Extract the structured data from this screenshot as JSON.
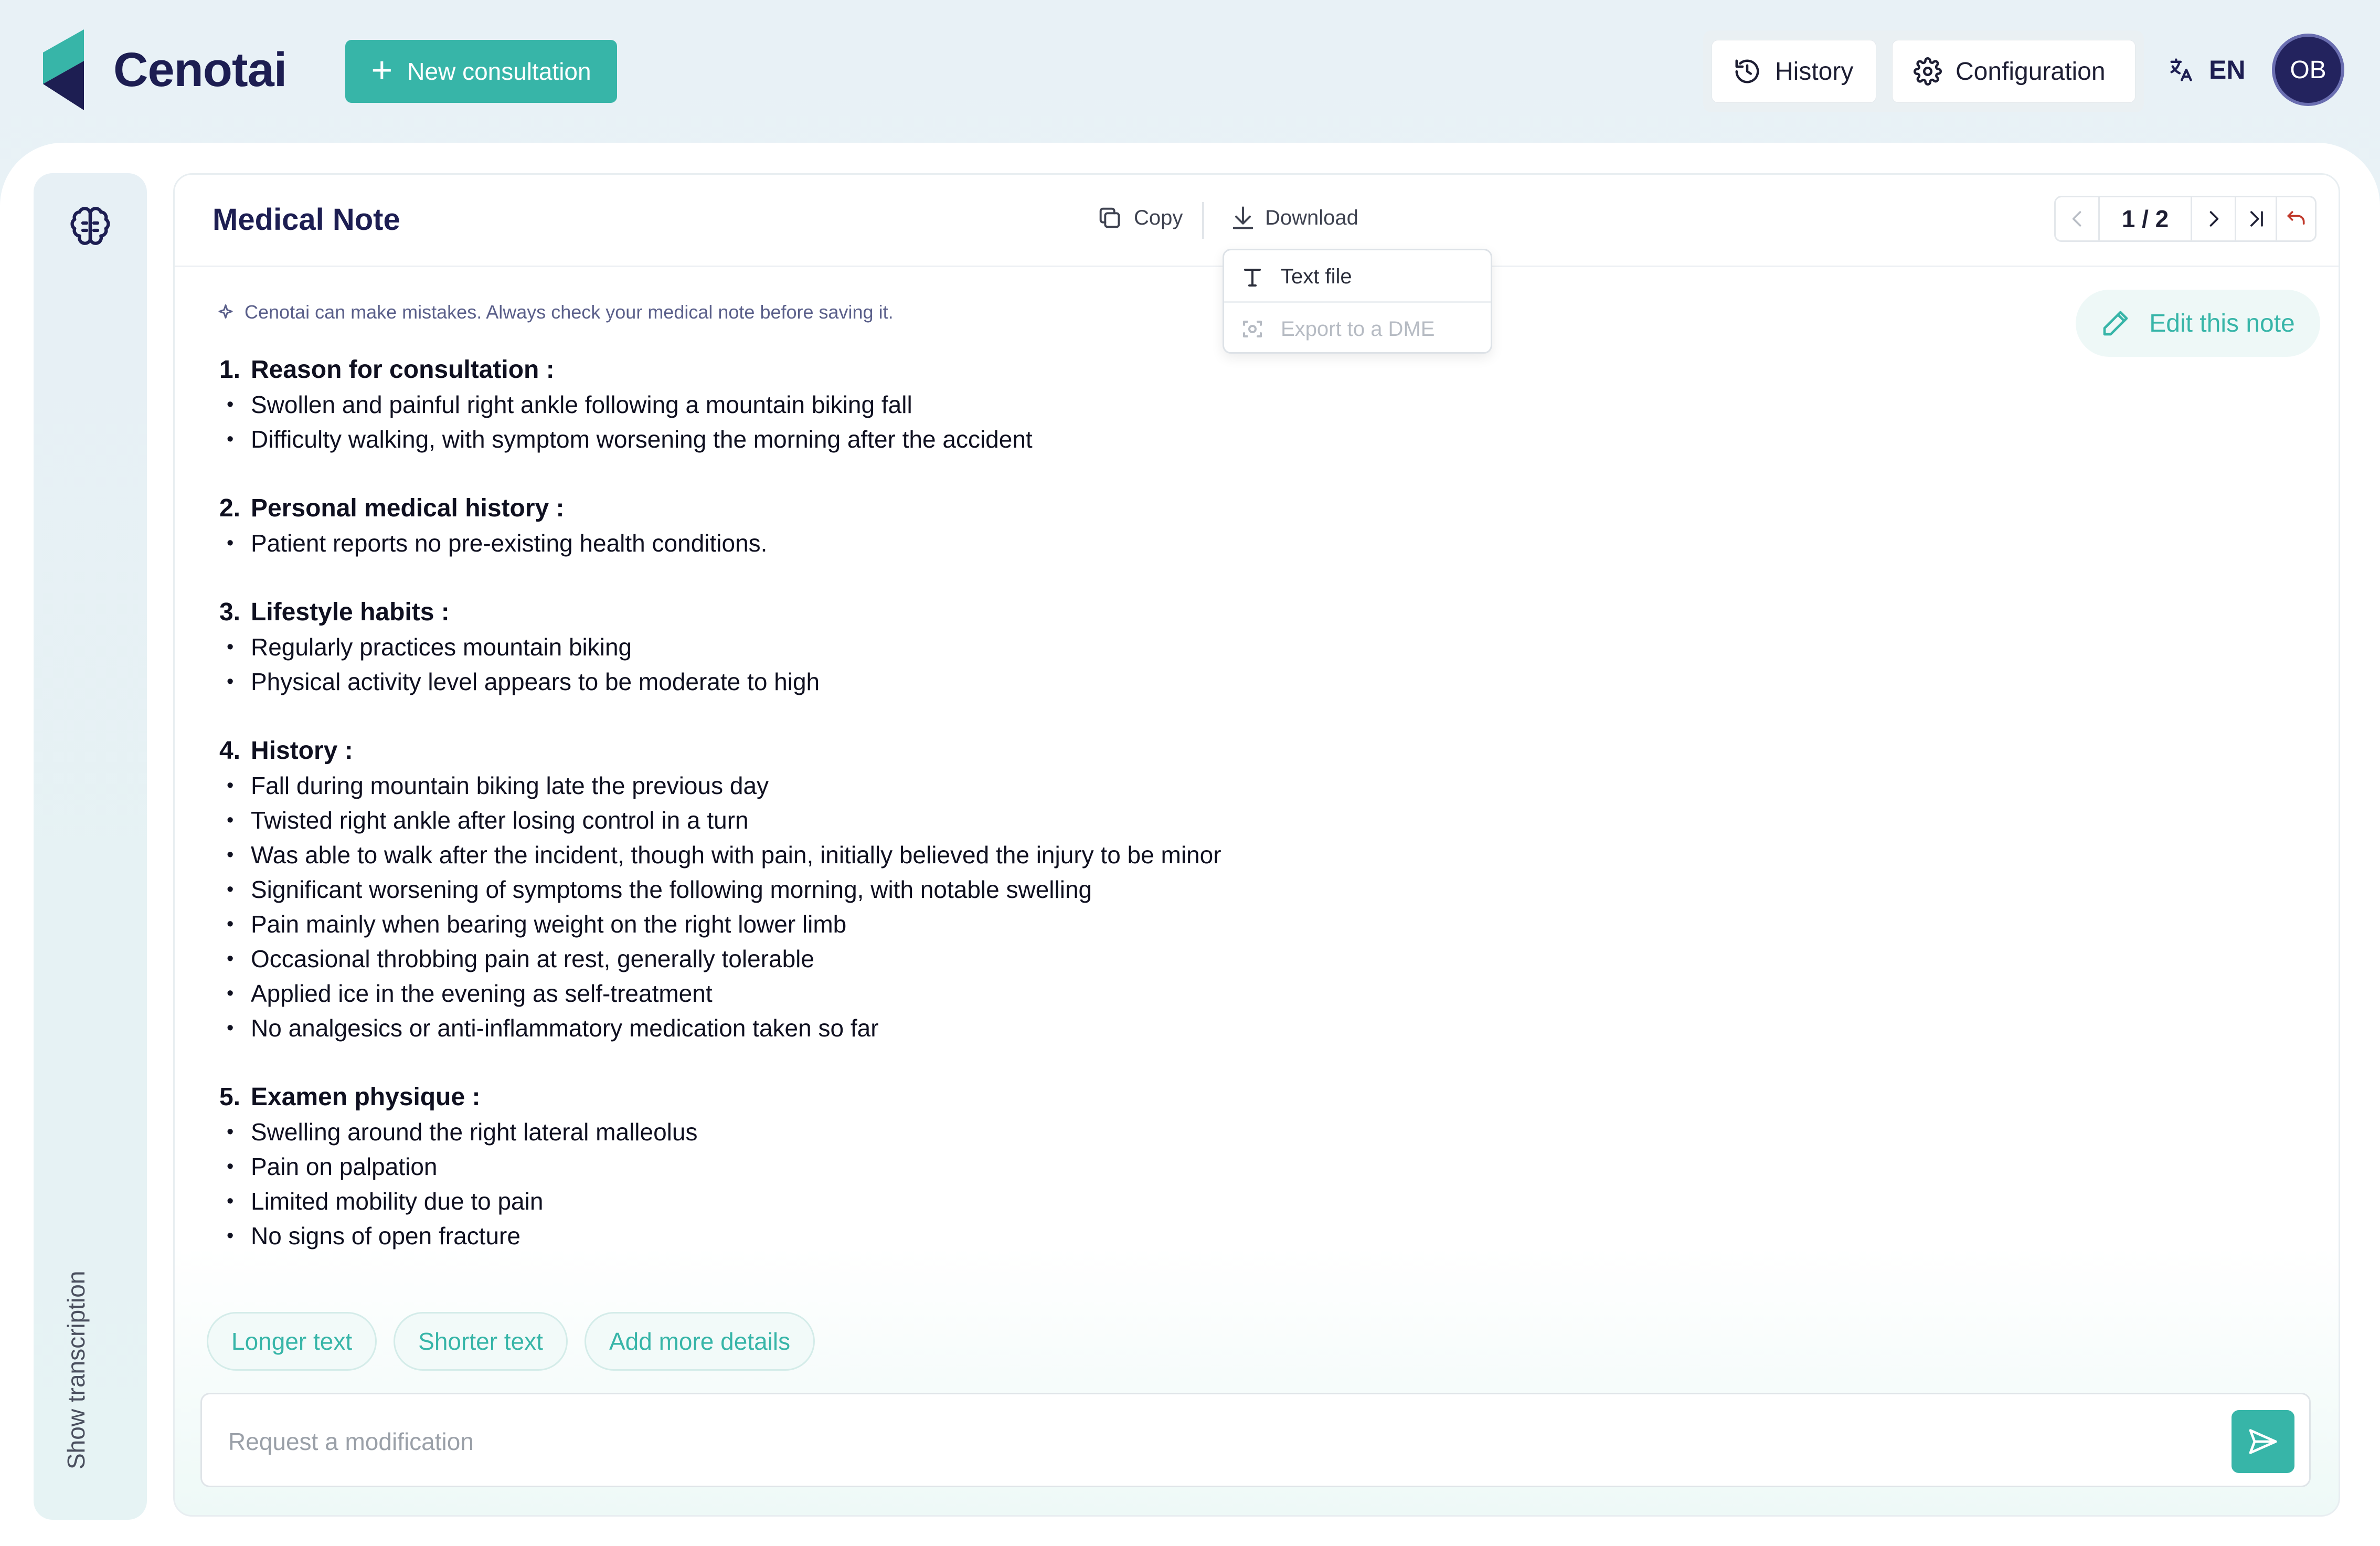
{
  "header": {
    "brand": "Cenotai",
    "new_consultation_label": "New consultation",
    "history_label": "History",
    "configuration_label": "Configuration",
    "language": "EN",
    "avatar_initials": "OB"
  },
  "sidebar": {
    "show_transcription_label": "Show transcription"
  },
  "note": {
    "title": "Medical Note",
    "copy_label": "Copy",
    "download_label": "Download",
    "page_indicator": "1 / 2",
    "download_menu": [
      "Text file",
      "Export to a DME"
    ],
    "disclaimer": "Cenotai can make mistakes. Always check your medical note before saving it.",
    "edit_label": "Edit this note",
    "sections": [
      {
        "num": "1.",
        "title": "Reason for consultation :",
        "items": [
          "Swollen and painful right ankle following a mountain biking fall",
          "Difficulty walking, with symptom worsening the morning after the accident"
        ]
      },
      {
        "num": "2.",
        "title": "Personal medical history :",
        "items": [
          "Patient reports no pre-existing health conditions."
        ]
      },
      {
        "num": "3.",
        "title": "Lifestyle habits :",
        "items": [
          "Regularly practices mountain biking",
          "Physical activity level appears to be moderate to high"
        ]
      },
      {
        "num": "4.",
        "title": "History :",
        "items": [
          "Fall during mountain biking late the previous day",
          "Twisted right ankle after losing control in a turn",
          "Was able to walk after the incident, though with pain, initially believed the injury to be minor",
          "Significant worsening of symptoms the following morning, with notable swelling",
          "Pain mainly when bearing weight on the right lower limb",
          "Occasional throbbing pain at rest, generally tolerable",
          "Applied ice in the evening as self-treatment",
          "No analgesics or anti-inflammatory medication taken so far"
        ]
      },
      {
        "num": "5.",
        "title": "Examen physique :",
        "items": [
          "Swelling around the right lateral malleolus",
          "Pain on palpation",
          "Limited mobility due to pain",
          "No signs of open fracture"
        ]
      }
    ],
    "suggestions": [
      "Longer text",
      "Shorter text",
      "Add more details"
    ],
    "request_placeholder": "Request a modification"
  },
  "colors": {
    "accent": "#37b5a8",
    "brand_dark": "#1d1e52",
    "undo": "#c0392b"
  }
}
